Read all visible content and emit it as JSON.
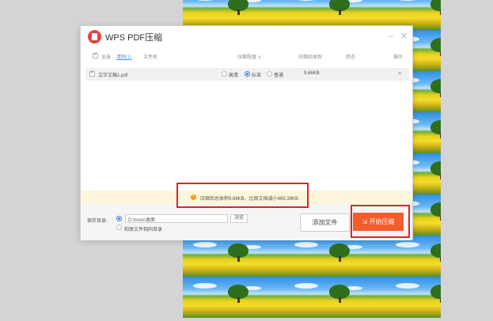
{
  "window": {
    "title": "WPS PDF压缩",
    "minimize_glyph": "–",
    "close_glyph": "✕"
  },
  "table_header": {
    "select_all": "全选",
    "clear_list": "清除(1)",
    "filename": "文件名",
    "compress_level": "压缩程度 ∨",
    "compressed_size": "压缩后体积",
    "status": "状态",
    "actions": "操作"
  },
  "files": [
    {
      "name": "文字文稿1.pdf",
      "levels": [
        "高清",
        "标准",
        "普通"
      ],
      "selected_level": "标准",
      "compressed_size": "9.66KB",
      "remove_glyph": "✕"
    }
  ],
  "notice": {
    "icon": "warning-icon",
    "text": "压缩后总体积9.66KB，比原文档减小465.39KB"
  },
  "footer": {
    "save_dir_label": "保存目录:",
    "save_path": "D:\\tools\\桌面",
    "browse": "浏览",
    "same_as_source": "和原文件相同目录",
    "add_file": "添加文件",
    "start_compress": "开始压缩"
  },
  "colors": {
    "accent": "#f25d2b",
    "highlight": "#d9252a",
    "notice_bg": "#fdf6dc",
    "radio_blue": "#3a7be0"
  }
}
